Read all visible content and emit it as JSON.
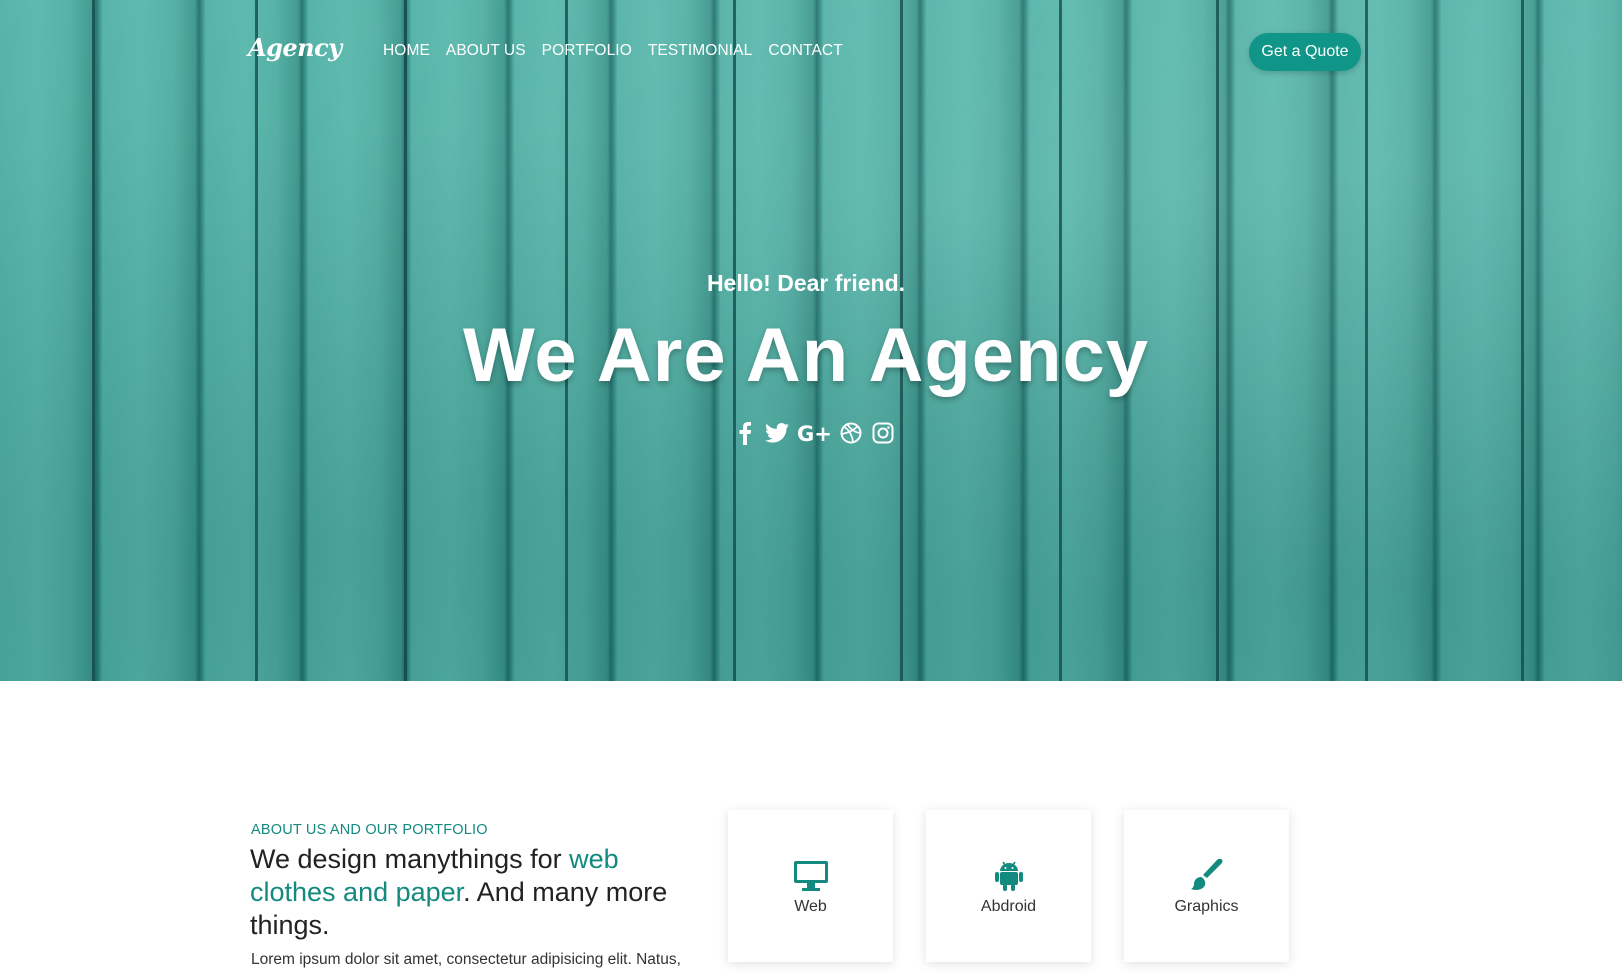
{
  "nav": {
    "logo": "Agency",
    "menu": [
      {
        "label": "HOME"
      },
      {
        "label": "ABOUT US"
      },
      {
        "label": "PORTFOLIO"
      },
      {
        "label": "TESTIMONIAL"
      },
      {
        "label": "CONTACT"
      }
    ],
    "cta": "Get a Quote"
  },
  "hero": {
    "subtitle": "Hello! Dear friend.",
    "title": "We Are An Agency",
    "socials": [
      "facebook-icon",
      "twitter-icon",
      "google-plus-icon",
      "dribbble-icon",
      "instagram-icon"
    ]
  },
  "about": {
    "kicker": "ABOUT US AND OUR PORTFOLIO",
    "heading_pre": "We design manythings for ",
    "heading_accent": "web clothes and paper",
    "heading_post": ". And many more things.",
    "body": "Lorem ipsum dolor sit amet, consectetur adipisicing elit. Natus,"
  },
  "services": [
    {
      "label": "Web",
      "icon": "monitor-icon"
    },
    {
      "label": "Abdroid",
      "icon": "android-icon"
    },
    {
      "label": "Graphics",
      "icon": "paintbrush-icon"
    }
  ],
  "colors": {
    "accent": "#138a7f",
    "button": "#0f9688",
    "hero_base": "#52b3a7"
  }
}
